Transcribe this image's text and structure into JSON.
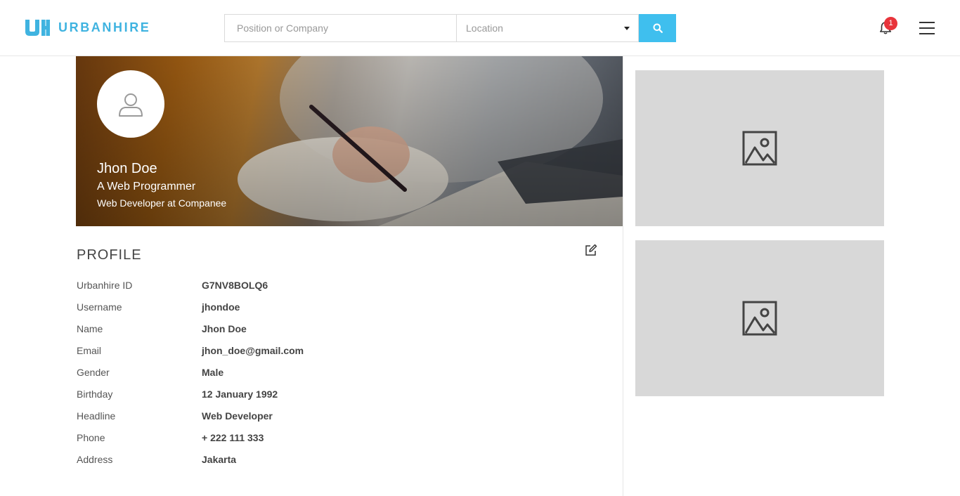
{
  "header": {
    "logo_text": "URBANHIRE",
    "search_placeholder": "Position or Company",
    "location_placeholder": "Location",
    "notification_count": "1",
    "accent_color": "#3fbfee"
  },
  "cover": {
    "name": "Jhon Doe",
    "headline": "A Web Programmer",
    "job": "Web Developer at Companee"
  },
  "profile": {
    "title": "PROFILE",
    "rows": [
      {
        "label": "Urbanhire ID",
        "value": "G7NV8BOLQ6"
      },
      {
        "label": "Username",
        "value": "jhondoe"
      },
      {
        "label": "Name",
        "value": "Jhon Doe"
      },
      {
        "label": "Email",
        "value": "jhon_doe@gmail.com"
      },
      {
        "label": "Gender",
        "value": "Male"
      },
      {
        "label": "Birthday",
        "value": "12 January 1992"
      },
      {
        "label": "Headline",
        "value": "Web Developer"
      },
      {
        "label": "Phone",
        "value": "+ 222 111 333"
      },
      {
        "label": "Address",
        "value": "Jakarta"
      }
    ]
  },
  "icons": {
    "logo": "urbanhire-logo-icon",
    "search": "search-icon",
    "bell": "bell-icon",
    "menu": "hamburger-menu-icon",
    "avatar": "user-icon",
    "edit": "edit-icon",
    "image_placeholder": "image-icon"
  }
}
